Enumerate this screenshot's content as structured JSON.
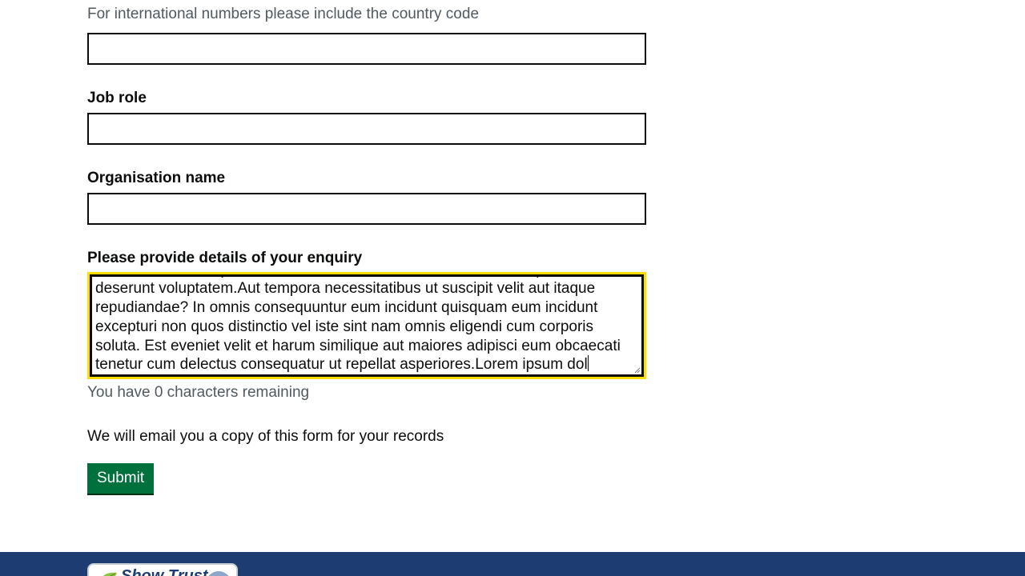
{
  "phone_field": {
    "hint": "For international numbers please include the country code",
    "value": ""
  },
  "job_role_field": {
    "label": "Job role",
    "value": ""
  },
  "organisation_field": {
    "label": "Organisation name",
    "value": ""
  },
  "enquiry_field": {
    "label": "Please provide details of your enquiry",
    "value": "laudantium ad temporibus nobis sed accusamus sint eum rerum quis et deserunt voluptatem.Aut tempora necessitatibus ut suscipit velit aut itaque repudiandae? In omnis consequuntur eum incidunt quisquam eum incidunt excepturi non quos distinctio vel iste sint nam omnis eligendi cum corporis soluta. Est eveniet velit et harum similique aut maiores adipisci eum obcaecati tenetur cum delectus consequatur ut repellat asperiores.Lorem ipsum dol",
    "character_count_message": "You have 0 characters remaining"
  },
  "email_copy_note": "We will email you a copy of this form for your records",
  "submit_label": "Submit",
  "footer": {
    "badge_text": "Show Trust",
    "badge_icon": "leaf-icon"
  },
  "colors": {
    "focus": "#ffdd00",
    "submit": "#00703c",
    "footer": "#1d3c72",
    "hint_text": "#505a5f"
  }
}
